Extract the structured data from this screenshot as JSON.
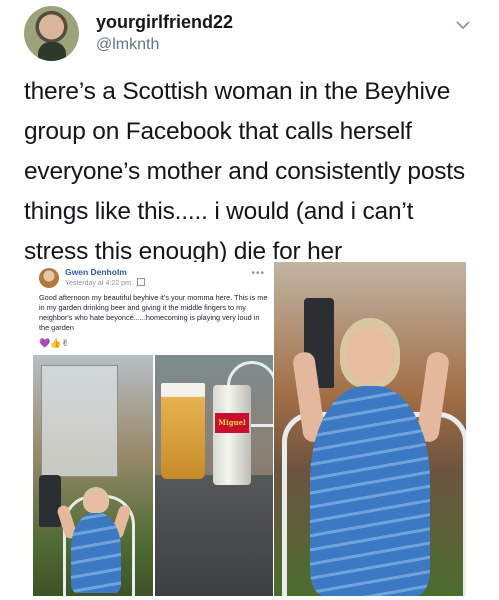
{
  "tweet": {
    "display_name": "yourgirlfriend22",
    "handle": "@lmknth",
    "text": "there’s a Scottish woman in the Beyhive group on Facebook that calls herself everyone’s mother and consistently posts things like this..... i would (and i can’t stress this enough) die for her"
  },
  "facebook_post": {
    "author": "Gwen Denholm",
    "meta": "Yesterday at 4:22 pm · ",
    "text": "Good afternoon my beautiful beyhive it's your momma here. This is me in my garden drinking beer and giving it the middle fingers to my neighbor's who hate beyoncé......homecoming is playing very loud in the garden",
    "emojis": "💜👍✌",
    "menu": "•••"
  },
  "photos": {
    "can_label": "Miguel"
  },
  "icons": [
    "chevron-down-icon",
    "globe-icon",
    "more-icon"
  ],
  "colors": {
    "fb_link": "#365899",
    "handle_gray": "#657786"
  }
}
